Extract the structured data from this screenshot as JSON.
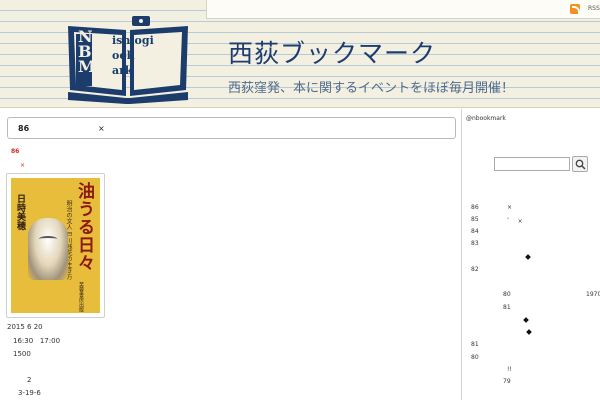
{
  "header": {
    "title": "西荻ブックマーク",
    "tagline": "西荻窪発、本に関するイベントをほぼ毎月開催！",
    "rss_label": "RSS",
    "logo": {
      "caps": [
        "N",
        "B",
        "M"
      ],
      "rest": [
        "ishiogi",
        "ook",
        "ark"
      ]
    }
  },
  "post": {
    "title_number": "86",
    "title_close": "×",
    "tag_number": "86",
    "tag_x": "×",
    "book": {
      "author": "日時美穂",
      "title": "油うる日々",
      "subtitle": "明治の文人 戸川残花の生き方",
      "publisher": "芙蓉書房出版"
    },
    "meta": {
      "date": "2015 6 20",
      "time": "16:30   17:00",
      "price": "1500",
      "venue_line1": "2",
      "venue_line2": "3-19-6"
    }
  },
  "sidebar": {
    "handle": "@nbookmark",
    "search_placeholder": "",
    "items": [
      {
        "num": "86",
        "suffix": "×"
      },
      {
        "num": "85",
        "suffix": "ﾞ    ×"
      },
      {
        "num": "84",
        "suffix": ""
      },
      {
        "num": "83",
        "suffix": ""
      },
      {
        "num": "82",
        "suffix": ""
      },
      {
        "num": "80",
        "suffix": "1970"
      },
      {
        "num": "81",
        "suffix": ""
      },
      {
        "num": "81",
        "suffix": ""
      },
      {
        "num": "80",
        "suffix": ""
      },
      {
        "num": "79",
        "suffix": "!!"
      }
    ]
  }
}
